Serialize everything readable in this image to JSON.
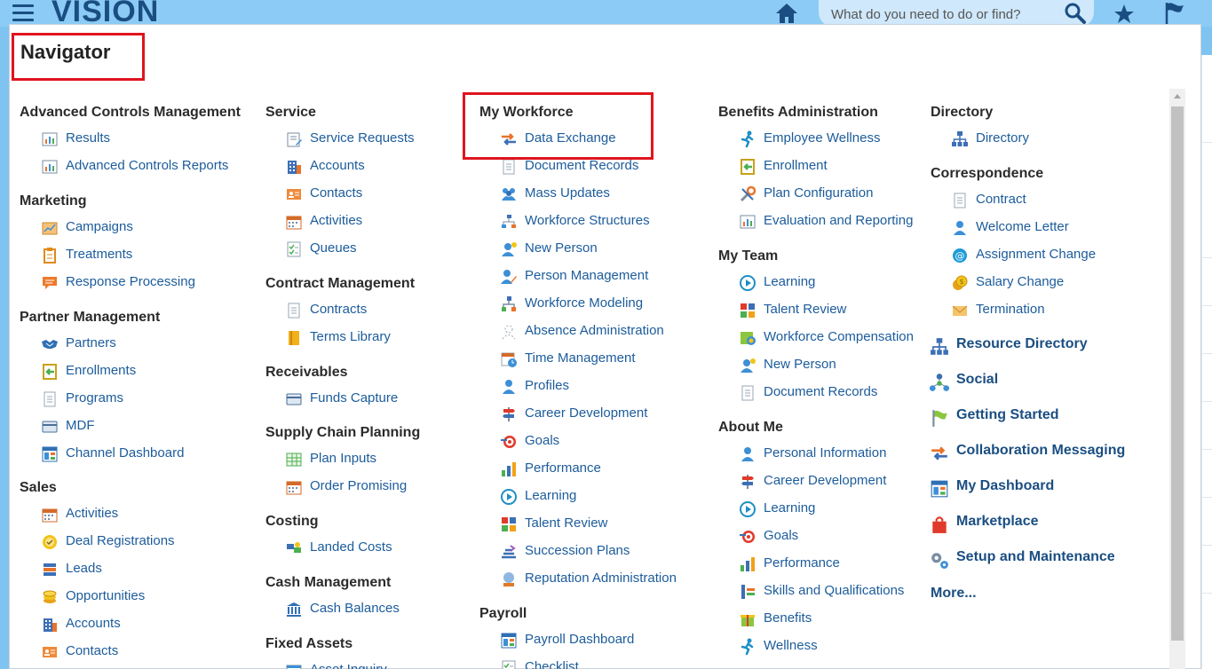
{
  "header": {
    "app_title": "VISION",
    "search_placeholder": "What do you need to do or find?"
  },
  "navigator": {
    "title": "Navigator",
    "col1": [
      {
        "title": "Advanced Controls Management",
        "items": [
          {
            "label": "Results",
            "icon": "report-chart-icon"
          },
          {
            "label": "Advanced Controls Reports",
            "icon": "report-chart-icon"
          }
        ]
      },
      {
        "title": "Marketing",
        "items": [
          {
            "label": "Campaigns",
            "icon": "campaign-icon"
          },
          {
            "label": "Treatments",
            "icon": "clipboard-icon"
          },
          {
            "label": "Response Processing",
            "icon": "speech-bubble-icon"
          }
        ]
      },
      {
        "title": "Partner Management",
        "items": [
          {
            "label": "Partners",
            "icon": "handshake-icon"
          },
          {
            "label": "Enrollments",
            "icon": "enroll-arrow-icon"
          },
          {
            "label": "Programs",
            "icon": "document-icon"
          },
          {
            "label": "MDF",
            "icon": "card-icon"
          },
          {
            "label": "Channel Dashboard",
            "icon": "dashboard-icon"
          }
        ]
      },
      {
        "title": "Sales",
        "items": [
          {
            "label": "Activities",
            "icon": "calendar-icon"
          },
          {
            "label": "Deal Registrations",
            "icon": "seal-icon"
          },
          {
            "label": "Leads",
            "icon": "stack-icon"
          },
          {
            "label": "Opportunities",
            "icon": "coins-icon"
          },
          {
            "label": "Accounts",
            "icon": "building-icon"
          },
          {
            "label": "Contacts",
            "icon": "contact-card-icon"
          }
        ]
      }
    ],
    "col2": [
      {
        "title": "Service",
        "items": [
          {
            "label": "Service Requests",
            "icon": "request-form-icon"
          },
          {
            "label": "Accounts",
            "icon": "building-icon"
          },
          {
            "label": "Contacts",
            "icon": "contact-card-icon"
          },
          {
            "label": "Activities",
            "icon": "calendar-icon"
          },
          {
            "label": "Queues",
            "icon": "checklist-icon"
          }
        ]
      },
      {
        "title": "Contract Management",
        "items": [
          {
            "label": "Contracts",
            "icon": "document-icon"
          },
          {
            "label": "Terms Library",
            "icon": "book-icon"
          }
        ]
      },
      {
        "title": "Receivables",
        "items": [
          {
            "label": "Funds Capture",
            "icon": "card-icon"
          }
        ]
      },
      {
        "title": "Supply Chain Planning",
        "items": [
          {
            "label": "Plan Inputs",
            "icon": "grid-sheet-icon"
          },
          {
            "label": "Order Promising",
            "icon": "calendar-icon"
          }
        ]
      },
      {
        "title": "Costing",
        "items": [
          {
            "label": "Landed Costs",
            "icon": "cost-icon"
          }
        ]
      },
      {
        "title": "Cash Management",
        "items": [
          {
            "label": "Cash Balances",
            "icon": "bank-icon"
          }
        ]
      },
      {
        "title": "Fixed Assets",
        "items": [
          {
            "label": "Asset Inquiry",
            "icon": "asset-icon"
          }
        ]
      }
    ],
    "col3": [
      {
        "title": "My Workforce",
        "items": [
          {
            "label": "Data Exchange",
            "icon": "exchange-arrows-icon"
          },
          {
            "label": "Document Records",
            "icon": "document-icon"
          },
          {
            "label": "Mass Updates",
            "icon": "people-group-icon"
          },
          {
            "label": "Workforce Structures",
            "icon": "structure-icon"
          },
          {
            "label": "New Person",
            "icon": "new-person-icon"
          },
          {
            "label": "Person Management",
            "icon": "person-edit-icon"
          },
          {
            "label": "Workforce Modeling",
            "icon": "org-model-icon"
          },
          {
            "label": "Absence Administration",
            "icon": "absence-icon"
          },
          {
            "label": "Time Management",
            "icon": "calendar-clock-icon"
          },
          {
            "label": "Profiles",
            "icon": "profile-icon"
          },
          {
            "label": "Career Development",
            "icon": "signpost-icon"
          },
          {
            "label": "Goals",
            "icon": "target-icon"
          },
          {
            "label": "Performance",
            "icon": "bar-chart-icon"
          },
          {
            "label": "Learning",
            "icon": "play-circle-icon"
          },
          {
            "label": "Talent Review",
            "icon": "grid-squares-icon"
          },
          {
            "label": "Succession Plans",
            "icon": "stairs-icon"
          },
          {
            "label": "Reputation Administration",
            "icon": "crystal-ball-icon"
          }
        ]
      },
      {
        "title": "Payroll",
        "items": [
          {
            "label": "Payroll Dashboard",
            "icon": "dashboard-icon"
          },
          {
            "label": "Checklist",
            "icon": "checklist-icon"
          }
        ]
      }
    ],
    "col4": [
      {
        "title": "Benefits Administration",
        "items": [
          {
            "label": "Employee Wellness",
            "icon": "runner-icon"
          },
          {
            "label": "Enrollment",
            "icon": "enroll-arrow-icon"
          },
          {
            "label": "Plan Configuration",
            "icon": "tools-icon"
          },
          {
            "label": "Evaluation and Reporting",
            "icon": "report-chart-icon"
          }
        ]
      },
      {
        "title": "My Team",
        "items": [
          {
            "label": "Learning",
            "icon": "play-circle-icon"
          },
          {
            "label": "Talent Review",
            "icon": "grid-squares-icon"
          },
          {
            "label": "Workforce Compensation",
            "icon": "compensation-icon"
          },
          {
            "label": "New Person",
            "icon": "new-person-icon"
          },
          {
            "label": "Document Records",
            "icon": "document-icon"
          }
        ]
      },
      {
        "title": "About Me",
        "items": [
          {
            "label": "Personal Information",
            "icon": "profile-icon"
          },
          {
            "label": "Career Development",
            "icon": "signpost-icon"
          },
          {
            "label": "Learning",
            "icon": "play-circle-icon"
          },
          {
            "label": "Goals",
            "icon": "target-icon"
          },
          {
            "label": "Performance",
            "icon": "bar-chart-icon"
          },
          {
            "label": "Skills and Qualifications",
            "icon": "skills-icon"
          },
          {
            "label": "Benefits",
            "icon": "benefits-icon"
          },
          {
            "label": "Wellness",
            "icon": "runner-icon"
          }
        ]
      }
    ],
    "col5": [
      {
        "title": "Directory",
        "items": [
          {
            "label": "Directory",
            "icon": "org-chart-icon"
          }
        ]
      },
      {
        "title": "Correspondence",
        "items": [
          {
            "label": "Contract",
            "icon": "document-icon"
          },
          {
            "label": "Welcome Letter",
            "icon": "profile-icon"
          },
          {
            "label": "Assignment Change",
            "icon": "at-sign-icon"
          },
          {
            "label": "Salary Change",
            "icon": "gold-coins-icon"
          },
          {
            "label": "Termination",
            "icon": "envelope-icon"
          }
        ]
      }
    ],
    "col5_big": [
      {
        "label": "Resource Directory",
        "icon": "org-chart-icon"
      },
      {
        "label": "Social",
        "icon": "network-icon"
      },
      {
        "label": "Getting Started",
        "icon": "flag-green-icon"
      },
      {
        "label": "Collaboration Messaging",
        "icon": "exchange-arrows-icon"
      },
      {
        "label": "My Dashboard",
        "icon": "dashboard-icon"
      },
      {
        "label": "Marketplace",
        "icon": "shopping-bag-icon"
      },
      {
        "label": "Setup and Maintenance",
        "icon": "gears-icon"
      }
    ],
    "more_label": "More..."
  }
}
